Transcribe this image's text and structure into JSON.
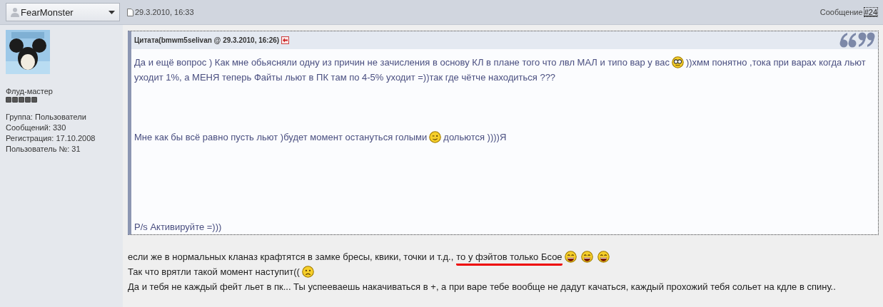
{
  "post_header": {
    "author": "FearMonster",
    "date": "29.3.2010, 16:33",
    "post_label": "Сообщение",
    "post_number": "#24"
  },
  "profile": {
    "avatar": {
      "kind": "picture"
    },
    "rank": "Флуд-мастер",
    "stars": 5,
    "info": [
      "Группа: Пользователи",
      "Сообщений: 330",
      "Регистрация: 17.10.2008",
      "Пользователь №: 31"
    ]
  },
  "quote": {
    "title": "Цитата(bmwm5selivan @ 29.3.2010, 16:26)",
    "paragraphs": [
      [
        [
          {
            "kind": "text",
            "text": "Да и ещё вопрос ) Как мне обьясняли одну из причин не зачисления в основу КЛ в плане того что лвл МАЛ и типо вар у вас"
          },
          {
            "kind": "glasses"
          },
          {
            "kind": "text",
            "text": "))хмм понятно ,тока при варах когда льют"
          }
        ],
        [
          {
            "kind": "text",
            "text": "уходит 1%, а МЕНЯ теперь Файты льют в ПК там по 4-5% уходит =))так где чётче находиться ???"
          }
        ]
      ],
      [
        [
          {
            "kind": "text",
            "text": "Мне как бы всё равно пусть льют )будет момент остануться голыми"
          },
          {
            "kind": "wink"
          },
          {
            "kind": "text",
            "text": "дольются ))))Я"
          }
        ]
      ],
      [
        [
          {
            "kind": "text",
            "text": "P/s Активируйте =)))"
          }
        ]
      ]
    ]
  },
  "message": [
    [
      {
        "kind": "text",
        "text": "если же в нормальных кланаз крафтятся в замке бресы, квики, точки и т.д.,"
      },
      {
        "kind": "text",
        "text": "то у фэйтов только Бсое",
        "marked": true
      },
      {
        "kind": "laugh"
      },
      {
        "kind": "laugh"
      },
      {
        "kind": "laugh"
      }
    ],
    [
      {
        "kind": "text",
        "text": "Так что врятли такой момент наступит(("
      },
      {
        "kind": "sad"
      }
    ],
    [
      {
        "kind": "text",
        "text": "Да и тебя не каждый фейт льет в пк... Ты успееваешь накачиваться в +, а при варе тебе вообще не дадут качаться, каждый прохожий тебя сольет на кдле в спину.."
      }
    ]
  ]
}
